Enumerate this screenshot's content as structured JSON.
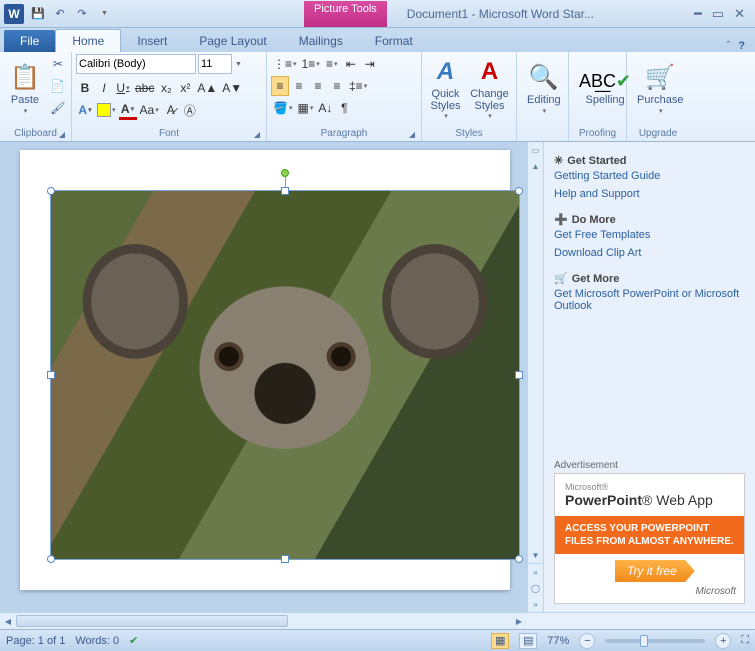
{
  "titlebar": {
    "app_letter": "W",
    "context_tab": "Picture Tools",
    "context_subtab": "Format",
    "title": "Document1 - Microsoft Word Star..."
  },
  "tabs": {
    "file": "File",
    "items": [
      "Home",
      "Insert",
      "Page Layout",
      "Mailings"
    ],
    "active_index": 0
  },
  "ribbon": {
    "clipboard": {
      "label": "Clipboard",
      "paste": "Paste"
    },
    "font": {
      "label": "Font",
      "family": "Calibri (Body)",
      "size": "11"
    },
    "paragraph": {
      "label": "Paragraph"
    },
    "styles": {
      "label": "Styles",
      "quick": "Quick Styles",
      "change": "Change Styles"
    },
    "editing": {
      "label": "Editing"
    },
    "proofing": {
      "label": "Proofing",
      "spelling": "Spelling"
    },
    "upgrade": {
      "label": "Upgrade",
      "purchase": "Purchase"
    }
  },
  "taskpane": {
    "s1_head": "Get Started",
    "s1_links": [
      "Getting Started Guide",
      "Help and Support"
    ],
    "s2_head": "Do More",
    "s2_links": [
      "Get Free Templates",
      "Download Clip Art"
    ],
    "s3_head": "Get More",
    "s3_links": [
      "Get Microsoft PowerPoint or Microsoft Outlook"
    ],
    "ad_label": "Advertisement",
    "ad_ms": "Microsoft®",
    "ad_title1": "PowerPoint",
    "ad_title2": "Web App",
    "ad_body": "ACCESS YOUR POWERPOINT FILES FROM ALMOST ANYWHERE.",
    "ad_cta": "Try it free",
    "ad_footer": "Microsoft"
  },
  "status": {
    "page": "Page: 1 of 1",
    "words": "Words: 0",
    "zoom": "77%"
  }
}
